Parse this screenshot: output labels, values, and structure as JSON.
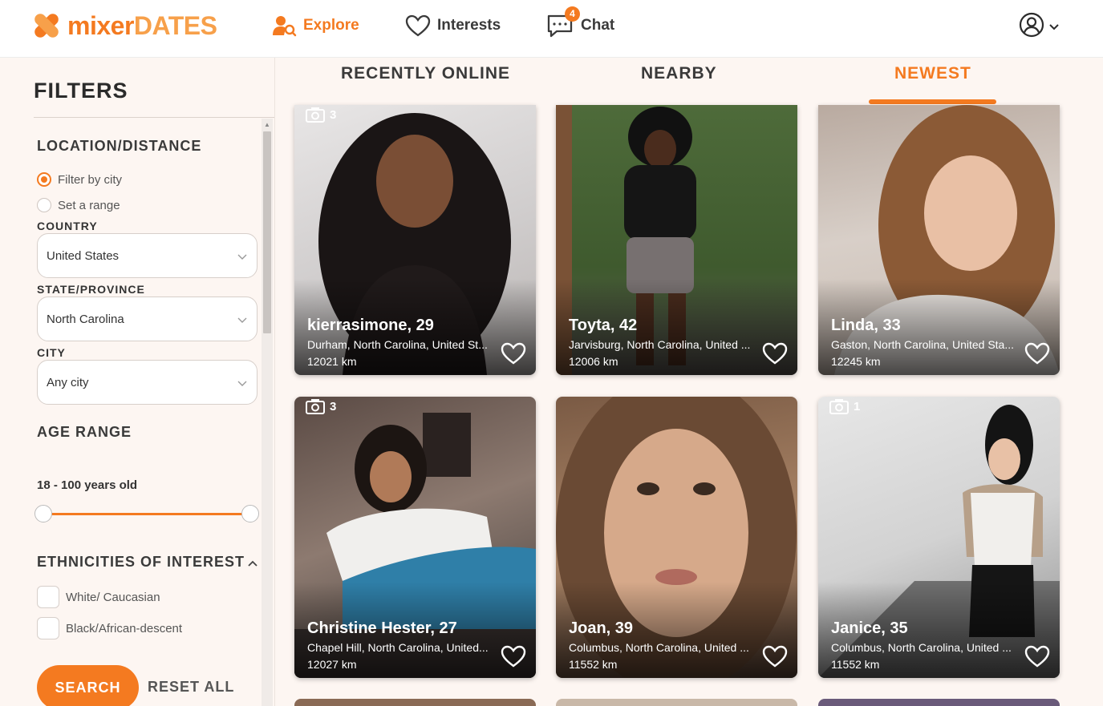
{
  "header": {
    "logo_part1": "mixer",
    "logo_part2": "DATES",
    "nav": {
      "explore": "Explore",
      "interests": "Interests",
      "chat": "Chat",
      "chat_badge": "4"
    }
  },
  "sidebar": {
    "title": "FILTERS",
    "location_title": "LOCATION/DISTANCE",
    "radio_city": "Filter by city",
    "radio_range": "Set a range",
    "country_label": "COUNTRY",
    "country_value": "United States",
    "state_label": "STATE/PROVINCE",
    "state_value": "North Carolina",
    "city_label": "CITY",
    "city_value": "Any city",
    "age_title": "AGE RANGE",
    "age_text": "18 - 100 years old",
    "age_min": 18,
    "age_max": 100,
    "ethnicities_title": "ETHNICITIES OF INTEREST",
    "ethnicity_1": "White/ Caucasian",
    "ethnicity_2": "Black/African-descent",
    "search_button": "SEARCH",
    "reset_button": "RESET ALL"
  },
  "tabs": {
    "recently_online": "RECENTLY ONLINE",
    "nearby": "NEARBY",
    "newest": "NEWEST",
    "active": "newest"
  },
  "profiles": [
    {
      "name": "kierrasimone, 29",
      "location": "Durham, North Carolina, United St...",
      "distance": "12021 km",
      "photos": "3"
    },
    {
      "name": "Toyta, 42",
      "location": "Jarvisburg, North Carolina, United ...",
      "distance": "12006 km",
      "photos": ""
    },
    {
      "name": "Linda, 33",
      "location": "Gaston, North Carolina, United Sta...",
      "distance": "12245 km",
      "photos": ""
    },
    {
      "name": "Christine Hester, 27",
      "location": "Chapel Hill, North Carolina, United...",
      "distance": "12027 km",
      "photos": "3"
    },
    {
      "name": "Joan, 39",
      "location": "Columbus, North Carolina, United ...",
      "distance": "11552 km",
      "photos": ""
    },
    {
      "name": "Janice, 35",
      "location": "Columbus, North Carolina, United ...",
      "distance": "11552 km",
      "photos": "1"
    }
  ],
  "colors": {
    "accent": "#f47a20",
    "background": "#fdf6f2"
  }
}
